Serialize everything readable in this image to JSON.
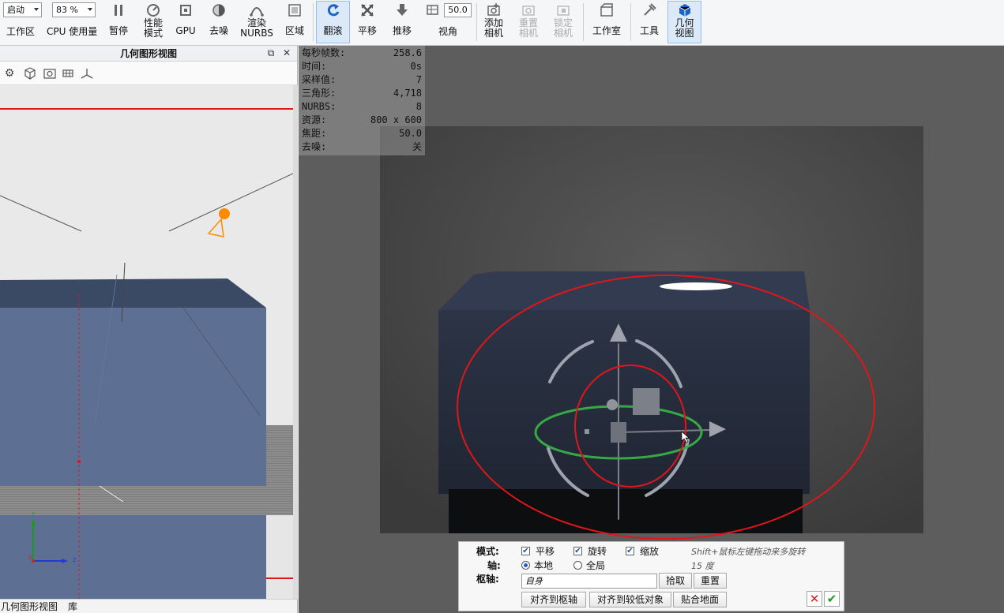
{
  "toolbar": {
    "startup_select": "启动",
    "workspace_label": "工作区",
    "cpu_usage_select": "83 %",
    "cpu_usage_label": "CPU 使用量",
    "pause": "暂停",
    "performance_mode": "性能\n模式",
    "gpu": "GPU",
    "denoise": "去噪",
    "render_nurbs": "渲染\nNURBS",
    "region": "区域",
    "tumble": "翻滚",
    "pan": "平移",
    "dolly": "推移",
    "fov_value": "50.0",
    "fov_label": "视角",
    "add_camera": "添加\n相机",
    "reset_camera": "重置\n相机",
    "lock_camera": "锁定\n相机",
    "studio": "工作室",
    "tools": "工具",
    "geometry_view": "几何\n视图"
  },
  "left_panel": {
    "title": "几何图形视图",
    "footer_tabs": [
      "几何图形视图",
      "库"
    ],
    "axis_labels": {
      "y": "Y",
      "x": "X",
      "z": "Z"
    }
  },
  "stats": [
    {
      "label": "每秒帧数:",
      "value": "258.6"
    },
    {
      "label": "时间:",
      "value": "0s"
    },
    {
      "label": "采样值:",
      "value": "7"
    },
    {
      "label": "三角形:",
      "value": "4,718"
    },
    {
      "label": "NURBS:",
      "value": "8"
    },
    {
      "label": "资源:",
      "value": "800 x 600"
    },
    {
      "label": "焦距:",
      "value": "50.0"
    },
    {
      "label": "去噪:",
      "value": "关"
    }
  ],
  "gizmo": {
    "mode_label": "模式:",
    "translate": "平移",
    "rotate": "旋转",
    "scale": "缩放",
    "translate_checked": true,
    "rotate_checked": true,
    "scale_checked": true,
    "hint_shift": "Shift+鼠标左键拖动来多旋转",
    "axis_label": "轴:",
    "local": "本地",
    "global": "全局",
    "hint_degrees": "15 度",
    "pivot_label": "枢轴:",
    "pivot_value": "自身",
    "pick": "拾取",
    "reset": "重置",
    "align_to_pivot": "对齐到枢轴",
    "align_to_lower": "对齐到较低对象",
    "snap_to_ground": "贴合地面"
  },
  "colors": {
    "accent_blue": "#1b63c6",
    "annotation_red": "#e0161b",
    "gizmo_green": "#37a845",
    "light_orange": "#ff8a00",
    "box_blue": "#5d7094"
  }
}
